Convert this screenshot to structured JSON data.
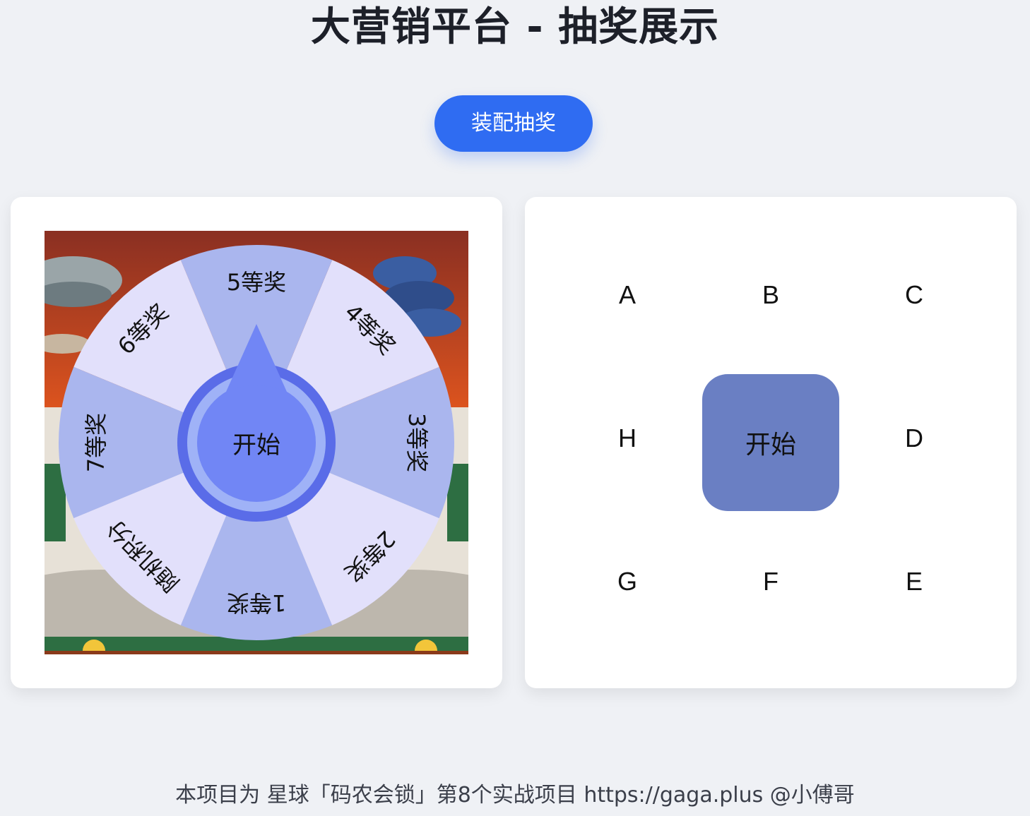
{
  "header": {
    "title": "大营销平台 - 抽奖展示"
  },
  "toolbar": {
    "assemble_label": "装配抽奖"
  },
  "wheel": {
    "prizes": [
      {
        "label": "1等奖",
        "color": "#aab6ee"
      },
      {
        "label": "2等奖",
        "color": "#e2e0fb"
      },
      {
        "label": "3等奖",
        "color": "#aab6ee"
      },
      {
        "label": "4等奖",
        "color": "#e2e0fb"
      },
      {
        "label": "5等奖",
        "color": "#aab6ee"
      },
      {
        "label": "6等奖",
        "color": "#e2e0fb"
      },
      {
        "label": "7等奖",
        "color": "#aab6ee"
      },
      {
        "label": "随机积分",
        "color": "#e2e0fb"
      }
    ],
    "start_label": "开始",
    "colors": {
      "button_ring": "#5a6ce8",
      "button_inner_ring": "#9fb2f7",
      "button_fill": "#7186f5"
    }
  },
  "grid": {
    "cells": {
      "a": "A",
      "b": "B",
      "c": "C",
      "d": "D",
      "e": "E",
      "f": "F",
      "g": "G",
      "h": "H"
    },
    "start_label": "开始",
    "start_color": "#6a7fc3"
  },
  "footer": {
    "text": "本项目为 星球「码农会锁」第8个实战项目 https://gaga.plus @小傅哥"
  }
}
